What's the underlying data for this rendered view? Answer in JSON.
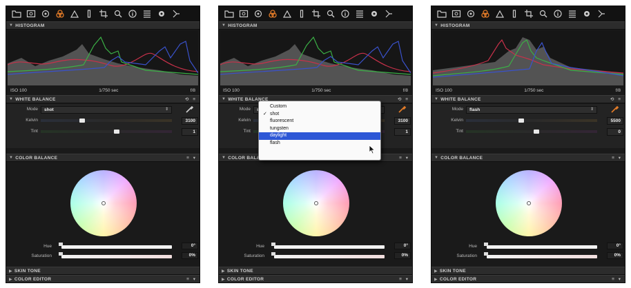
{
  "colors": {
    "panel_bg": "#1a1a1a",
    "accent": "#e07a28",
    "menu_selection": "#2d57d6"
  },
  "toolbar_icons": [
    "folder-icon",
    "image-icon",
    "magnifier-icon",
    "color-icon",
    "exposure-icon",
    "lens-icon",
    "crop-icon",
    "search-icon",
    "info-icon",
    "list-icon",
    "settings-icon",
    "export-icon"
  ],
  "panels": [
    {
      "histogram": {
        "title": "HISTOGRAM",
        "iso": "ISO 100",
        "shutter": "1/750 sec",
        "aperture": "f/8"
      },
      "white_balance": {
        "title": "WHITE BALANCE",
        "controls": "⟲ ≡",
        "mode_label": "Mode",
        "mode_value": "shot",
        "kelvin_label": "Kelvin",
        "kelvin_value": "3100",
        "tint_label": "Tint",
        "tint_value": "1"
      },
      "color_balance": {
        "title": "COLOR BALANCE",
        "hue_label": "Hue",
        "hue_value": "0°",
        "saturation_label": "Saturation",
        "saturation_value": "0%"
      },
      "skin_tone": "SKIN TONE",
      "color_editor": "COLOR EDITOR"
    },
    {
      "histogram": {
        "title": "HISTOGRAM",
        "iso": "ISO 100",
        "shutter": "1/750 sec",
        "aperture": "f/8"
      },
      "white_balance": {
        "title": "WHITE BALANCE",
        "controls": "⟲ ≡",
        "mode_label": "Mode",
        "mode_value": "shot",
        "kelvin_label": "Kelvin",
        "kelvin_value": "3100",
        "tint_label": "Tint",
        "tint_value": "1"
      },
      "color_balance": {
        "title": "COLOR BALANCE",
        "hue_label": "Hue",
        "hue_value": "0°",
        "saturation_label": "Saturation",
        "saturation_value": "0%"
      },
      "skin_tone": "SKIN TONE",
      "color_editor": "COLOR EDITOR",
      "dropdown": {
        "items": [
          "Custom",
          "shot",
          "fluorescent",
          "tungsten",
          "daylight",
          "flash"
        ],
        "checked": "shot",
        "highlighted": "daylight"
      }
    },
    {
      "histogram": {
        "title": "HISTOGRAM",
        "iso": "ISO 100",
        "shutter": "1/750 sec",
        "aperture": "f/8"
      },
      "white_balance": {
        "title": "WHITE BALANCE",
        "controls": "⟲ ≡",
        "mode_label": "Mode",
        "mode_value": "flash",
        "kelvin_label": "Kelvin",
        "kelvin_value": "5500",
        "tint_label": "Tint",
        "tint_value": "0"
      },
      "color_balance": {
        "title": "COLOR BALANCE",
        "hue_label": "Hue",
        "hue_value": "0°",
        "saturation_label": "Saturation",
        "saturation_value": "0%"
      },
      "skin_tone": "SKIN TONE",
      "color_editor": "COLOR EDITOR"
    }
  ]
}
